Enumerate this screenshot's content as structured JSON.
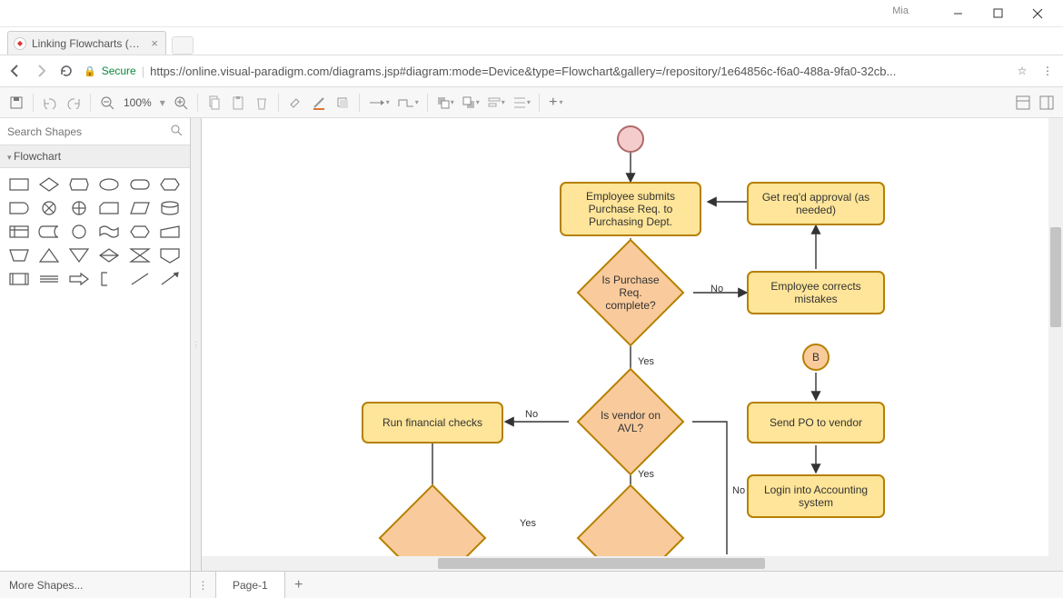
{
  "window": {
    "user": "Mia"
  },
  "browser": {
    "tab_title": "Linking Flowcharts (Part",
    "secure_label": "Secure",
    "url": "https://online.visual-paradigm.com/diagrams.jsp#diagram:mode=Device&type=Flowchart&gallery=/repository/1e64856c-f6a0-488a-9fa0-32cb..."
  },
  "toolbar": {
    "zoom": "100%"
  },
  "sidebar": {
    "search_placeholder": "Search Shapes",
    "palette_title": "Flowchart",
    "more_shapes": "More Shapes..."
  },
  "pages": {
    "tab1": "Page-1"
  },
  "flow": {
    "start": "",
    "n1": "Employee submits Purchase Req. to Purchasing Dept.",
    "n2": "Get req'd approval (as needed)",
    "d1": "Is Purchase Req. complete?",
    "n3": "Employee corrects mistakes",
    "n4": "Run financial checks",
    "d2": "Is vendor on AVL?",
    "conB": "B",
    "n5": "Send PO to vendor",
    "n6": "Login into Accounting system",
    "e_no1": "No",
    "e_yes1": "Yes",
    "e_no2": "No",
    "e_yes2": "Yes",
    "e_no3": "No",
    "e_yes3": "Yes"
  }
}
